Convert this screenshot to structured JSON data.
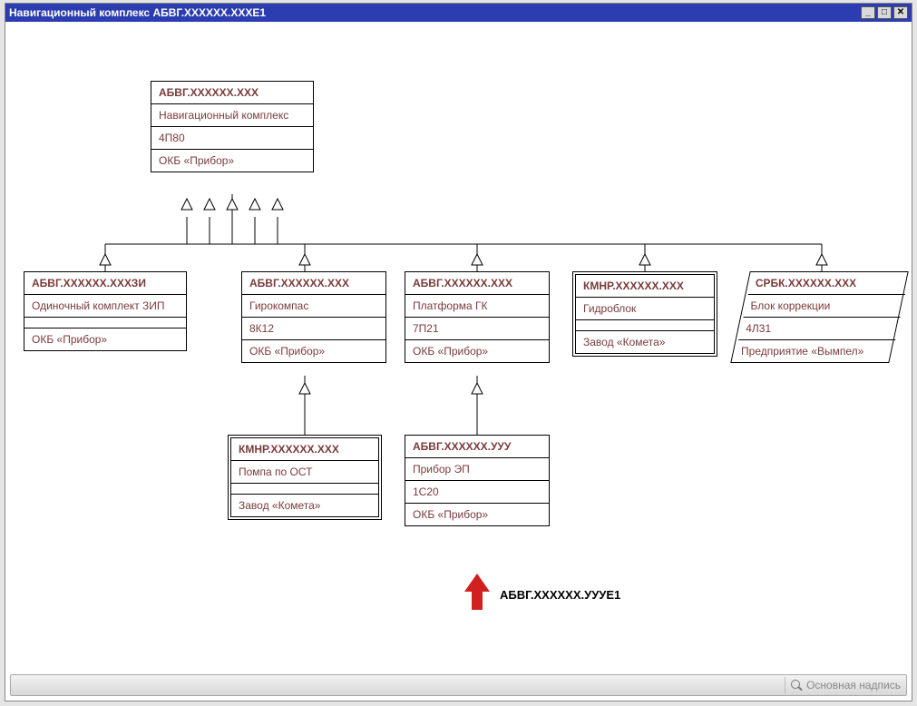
{
  "window": {
    "title": "Навигационный комплекс АБВГ.ХХХХХХ.ХХХЕ1"
  },
  "nodes": {
    "root": {
      "id": "АБВГ.ХХХХХХ.ХХХ",
      "desc": "Навигационный комплекс",
      "code": "4П80",
      "maker": "ОКБ «Прибор»"
    },
    "n1": {
      "id": "АБВГ.ХХХХХХ.ХХХЗИ",
      "desc": "Одиночный комплект ЗИП",
      "code": "",
      "maker": "ОКБ «Прибор»"
    },
    "n2": {
      "id": "АБВГ.ХХХХХХ.ХХХ",
      "desc": "Гирокомпас",
      "code": "8К12",
      "maker": "ОКБ «Прибор»"
    },
    "n3": {
      "id": "АБВГ.ХХХХХХ.ХХХ",
      "desc": "Платформа ГК",
      "code": "7П21",
      "maker": "ОКБ «Прибор»"
    },
    "n4": {
      "id": "КМНР.ХХХХХХ.ХХХ",
      "desc": "Гидроблок",
      "code": "",
      "maker": "Завод «Комета»"
    },
    "n5": {
      "id": "СРБК.ХХХХХХ.ХХХ",
      "desc": "Блок коррекции",
      "code": "4Л31",
      "maker": "Предприятие «Вымпел»"
    },
    "n2a": {
      "id": "КМНР.ХХХХХХ.ХХХ",
      "desc": "Помпа по ОСТ",
      "code": "",
      "maker": "Завод «Комета»"
    },
    "n3a": {
      "id": "АБВГ.ХХХХХХ.УУУ",
      "desc": "Прибор ЭП",
      "code": "1С20",
      "maker": "ОКБ «Прибор»"
    }
  },
  "annotation": {
    "label": "АБВГ.ХХХХХХ.УУУЕ1"
  },
  "statusbar": {
    "search_placeholder": "Основная надпись"
  },
  "colors": {
    "titlebar": "#2b3db0",
    "node_text": "#7a3b3b",
    "arrow_red": "#d12020"
  }
}
